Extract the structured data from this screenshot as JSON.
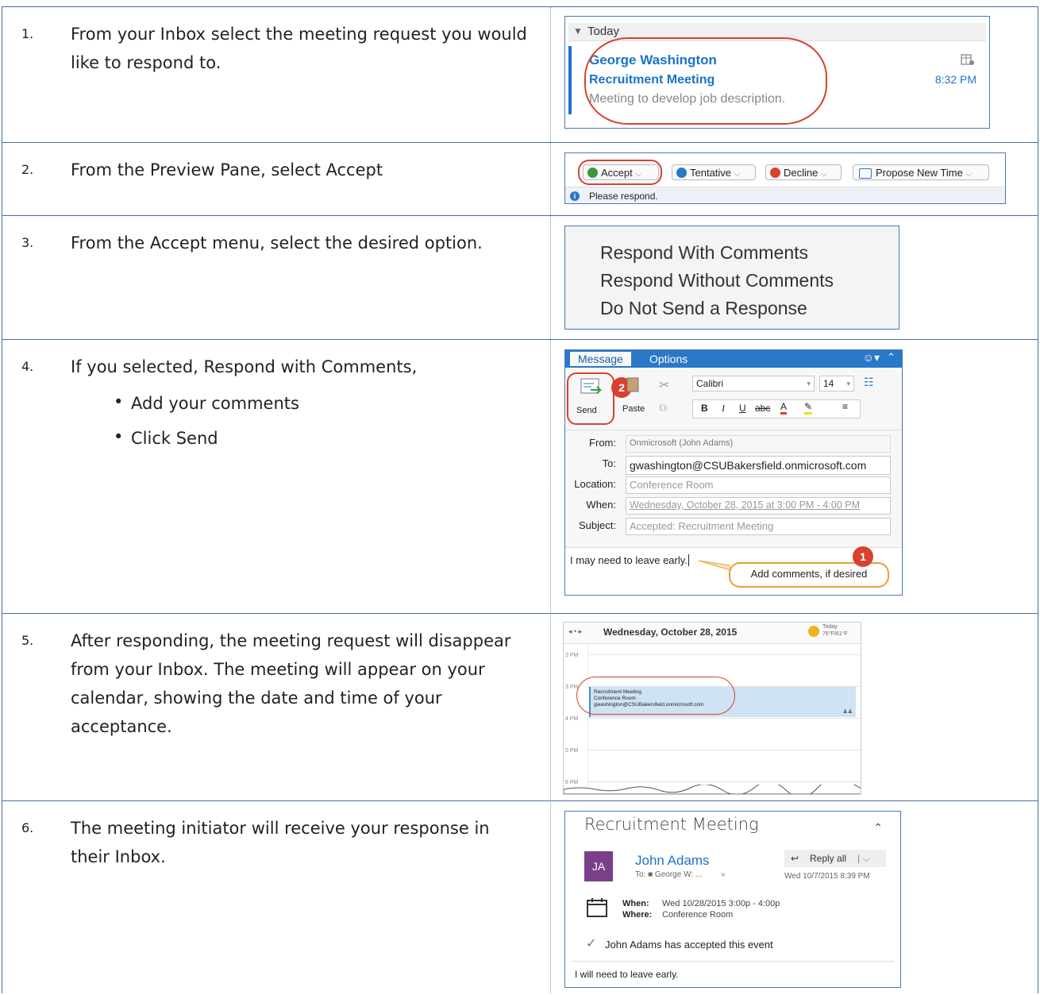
{
  "steps": [
    {
      "num": "1.",
      "text": "From your Inbox select the meeting request you would like to respond to."
    },
    {
      "num": "2.",
      "text": "From the Preview Pane, select Accept"
    },
    {
      "num": "3.",
      "text": "From the Accept menu, select the desired option."
    },
    {
      "num": "4.",
      "text": "If you selected, Respond with Comments,",
      "bullets": [
        "Add your comments",
        "Click Send"
      ]
    },
    {
      "num": "5.",
      "text": "After responding, the meeting request will disappear from your Inbox. The meeting will appear on your calendar, showing the date and time of your acceptance."
    },
    {
      "num": "6.",
      "text": "The meeting initiator will receive your response in their Inbox."
    }
  ],
  "inbox": {
    "group": "Today",
    "sender": "George Washington",
    "subject": "Recruitment Meeting",
    "time": "8:32 PM",
    "preview": "Meeting to develop job description."
  },
  "response_bar": {
    "accept": "Accept",
    "tentative": "Tentative",
    "decline": "Decline",
    "propose": "Propose New Time",
    "notice": "Please respond."
  },
  "accept_menu": [
    "Respond With Comments",
    "Respond Without Comments",
    "Do Not Send a Response"
  ],
  "compose": {
    "tabs": [
      "Message",
      "Options"
    ],
    "send": "Send",
    "paste": "Paste",
    "font": "Calibri",
    "size": "14",
    "from_label": "From:",
    "from": "Onmicrosoft (John Adams)",
    "to_label": "To:",
    "to": "gwashington@CSUBakersfield.onmicrosoft.com",
    "location_label": "Location:",
    "location": "Conference Room",
    "when_label": "When:",
    "when": "Wednesday, October 28, 2015 at 3:00 PM - 4:00 PM",
    "subject_label": "Subject:",
    "subject": "Accepted: Recruitment Meeting",
    "body": "I may need to leave early.",
    "callout": "Add comments, if desired",
    "badge1": "1",
    "badge2": "2",
    "format_bold": "B",
    "format_italic": "I",
    "format_underline": "U",
    "format_strike": "abc",
    "format_fontcolor": "A"
  },
  "calendar": {
    "date": "Wednesday, October 28, 2015",
    "weather_label": "Today",
    "weather_temp": "76°F/61°F",
    "hours": [
      "2 PM",
      "3 PM",
      "4 PM",
      "5 PM",
      "6 PM"
    ],
    "event_title": "Recruitment Meeting",
    "event_location": "Conference Room",
    "event_organizer": "gwashington@CSUBakersfield.onmicrosoft.com"
  },
  "reply": {
    "title": "Recruitment Meeting",
    "initials": "JA",
    "sender": "John Adams",
    "to": "To: ■ George W: ...",
    "reply_all": "Reply all",
    "date": "Wed 10/7/2015 8:39 PM",
    "when_label": "When:",
    "when": "Wed 10/28/2015 3:00p - 4:00p",
    "where_label": "Where:",
    "where": "Conference Room",
    "status": "John Adams has accepted this event",
    "body": "I will need to leave early."
  },
  "colors": {
    "accent": "#1a73c8",
    "red": "#d9412f",
    "border": "#4a6f9d",
    "purple": "#7b3f8a"
  }
}
